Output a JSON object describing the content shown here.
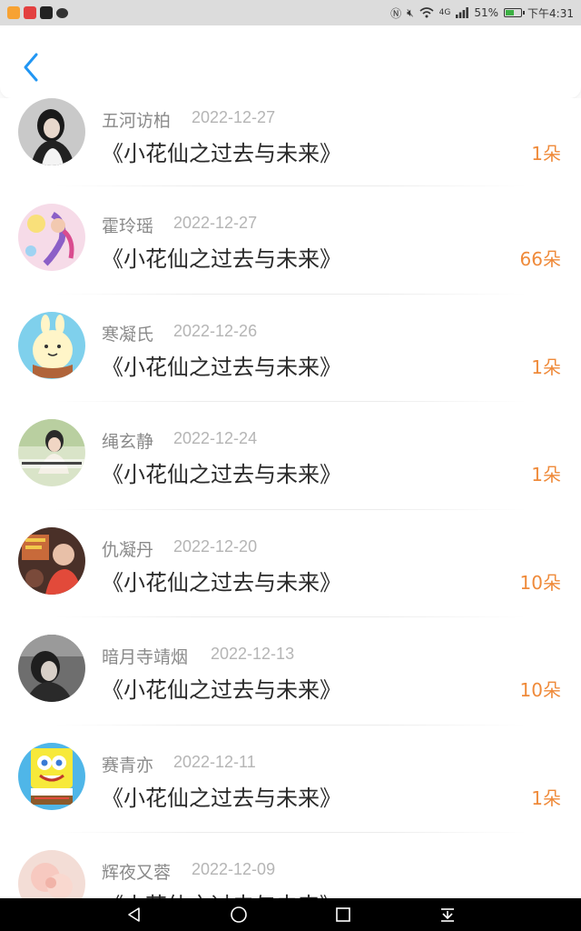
{
  "status_bar": {
    "battery": "51%",
    "battery_level": 0.51,
    "time": "下午4:31",
    "net_label": "4G",
    "app_icons": [
      "video-app-icon",
      "red-app-icon",
      "tiktok-icon",
      "chat-bubble-icon"
    ],
    "colors": {
      "bg": "#dcdcdc",
      "battery_fill": "#3cb043"
    }
  },
  "header": {
    "back_icon": "chevron-left-icon",
    "accent": "#2196f3"
  },
  "records": [
    {
      "name": "五河访柏",
      "date": "2022-12-27",
      "title": "《小花仙之过去与未来》",
      "count": "1朵"
    },
    {
      "name": "霍玲瑶",
      "date": "2022-12-27",
      "title": "《小花仙之过去与未来》",
      "count": "66朵"
    },
    {
      "name": "寒凝氏",
      "date": "2022-12-26",
      "title": "《小花仙之过去与未来》",
      "count": "1朵"
    },
    {
      "name": "绳玄静",
      "date": "2022-12-24",
      "title": "《小花仙之过去与未来》",
      "count": "1朵"
    },
    {
      "name": "仇凝丹",
      "date": "2022-12-20",
      "title": "《小花仙之过去与未来》",
      "count": "10朵"
    },
    {
      "name": "暗月寺靖烟",
      "date": "2022-12-13",
      "title": "《小花仙之过去与未来》",
      "count": "10朵"
    },
    {
      "name": "赛青亦",
      "date": "2022-12-11",
      "title": "《小花仙之过去与未来》",
      "count": "1朵"
    },
    {
      "name": "辉夜又蓉",
      "date": "2022-12-09",
      "title": "《小花仙之过去与未来》",
      "count": ""
    }
  ],
  "nav_bar": {
    "icons": [
      "back-triangle-icon",
      "home-circle-icon",
      "recents-square-icon",
      "notification-pulldown-icon"
    ]
  },
  "colors": {
    "count": "#ef8a3a",
    "name": "#8a8a8a",
    "date": "#b5b5b5",
    "title": "#2a2a2a"
  }
}
